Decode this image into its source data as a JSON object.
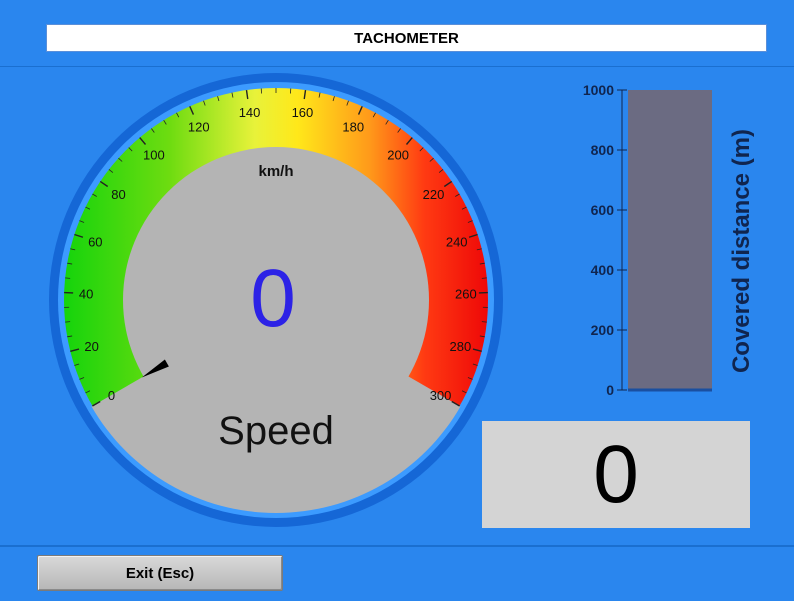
{
  "window": {
    "title": "TACHOMETER"
  },
  "speedometer": {
    "unit": "km/h",
    "value": 0,
    "value_text": "0",
    "label": "Speed",
    "tick_labels": [
      "0",
      "20",
      "40",
      "60",
      "80",
      "100",
      "120",
      "140",
      "160",
      "180",
      "200",
      "220",
      "240",
      "260",
      "280",
      "300"
    ],
    "min": 0,
    "max": 300,
    "colors": {
      "value": "#2c22e6",
      "gray_face": "#b4b4b4"
    }
  },
  "distance": {
    "axis_title": "Covered distance (m)",
    "tick_labels": [
      "1000",
      "800",
      "600",
      "400",
      "200",
      "0"
    ],
    "value": 0,
    "readout_text": "0",
    "max": 1000,
    "colors": {
      "bar": "#6b6b82"
    }
  },
  "footer": {
    "exit_label": "Exit (Esc)"
  }
}
